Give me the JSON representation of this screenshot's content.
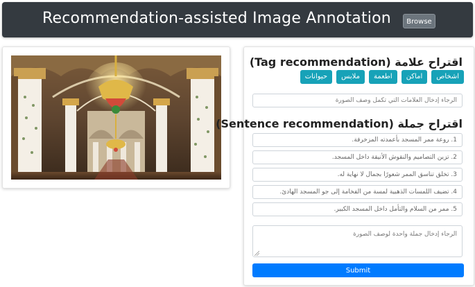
{
  "header": {
    "title": "Recommendation-assisted Image Annotation",
    "browse_label": "Browse"
  },
  "image": {
    "icon": "mosque-interior-photo"
  },
  "tags_section": {
    "title": "اقتراح علامة (Tag recommendation)",
    "tags": [
      "اشخاص",
      "اماكن",
      "اطعمة",
      "ملابس",
      "حيوانات"
    ],
    "input_placeholder": "الرجاء إدخال العلامات التي تكمل وصف الصورة"
  },
  "sentences_section": {
    "title": "اقتراح جملة (Sentence recommendation)",
    "sentences": [
      "1. روعة ممر المسجد بأعمدته المزخرفة.",
      "2. تزين التصاميم والنقوش الأنيقة داخل المسجد.",
      "3. تخلق تناسق الممر شعورًا بجمال لا نهاية له.",
      "4. تضيف اللمسات الذهبية لمسة من الفخامة إلى جو المسجد الهادئ.",
      "5. ممر من السلام والتأمل داخل المسجد الكبير."
    ],
    "textarea_placeholder": "الرجاء إدخال جملة واحدة لوصف الصورة",
    "submit_label": "Submit"
  },
  "colors": {
    "header_bg": "#343a40",
    "tag_button": "#17a2b8",
    "submit_button": "#007bff",
    "browse_button": "#6c757d"
  }
}
